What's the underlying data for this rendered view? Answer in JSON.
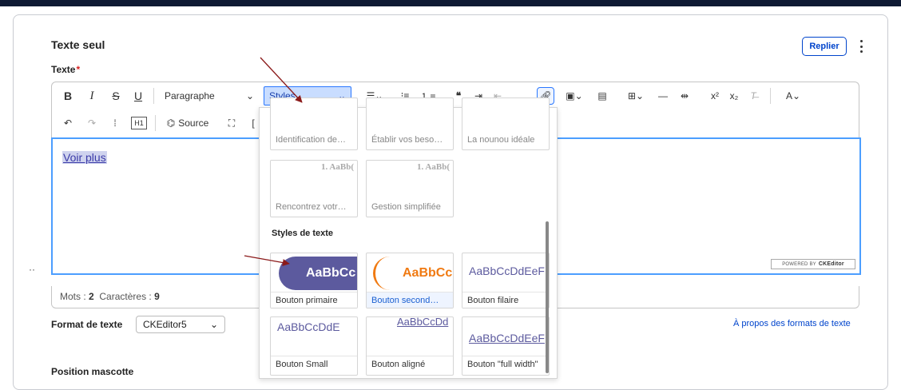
{
  "card": {
    "title": "Texte seul",
    "collapse_label": "Replier",
    "field_label": "Texte",
    "required_mark": "*"
  },
  "toolbar": {
    "bold": "B",
    "italic": "I",
    "strike": "S",
    "underline": "U",
    "paragraph_label": "Paragraphe",
    "styles_label": "Styles",
    "source_label": "Source",
    "heading_label": "H1"
  },
  "editor": {
    "link_text": "Voir plus",
    "powered_prefix": "POWERED BY",
    "powered_brand": "CKEditor"
  },
  "dropdown": {
    "block_styles_row1": [
      "Identification de…",
      "Établir vos beso…",
      "La nounou idéale"
    ],
    "block_styles_row2": [
      "Rencontrez votr…",
      "Gestion simplifiée"
    ],
    "block_preview_text": "1. AaBb(",
    "section_title": "Styles de texte",
    "text_styles": [
      {
        "label": "Bouton primaire",
        "preview": "AaBbCc"
      },
      {
        "label": "Bouton second…",
        "preview": "AaBbCc"
      },
      {
        "label": "Bouton filaire",
        "preview": "AaBbCcDdEeF"
      },
      {
        "label": "Bouton Small",
        "preview": "AaBbCcDdE"
      },
      {
        "label": "Bouton aligné",
        "preview": "AaBbCcDd"
      },
      {
        "label": "Bouton \"full width\"",
        "preview": "AaBbCcDdEeF"
      }
    ]
  },
  "footer": {
    "words_label": "Mots :",
    "words_value": "2",
    "chars_label": "Caractères :",
    "chars_value": "9",
    "format_label": "Format de texte",
    "format_value": "CKEditor5",
    "about_link": "À propos des formats de texte",
    "mascot_label": "Position mascotte"
  },
  "misc": {
    "drag_dots": "··"
  },
  "colors": {
    "accent": "#2977ff",
    "primary_button": "#5c5a9e",
    "secondary_button": "#f07a12",
    "link": "#0044cc",
    "annotation_arrow": "#8b1a1a"
  }
}
